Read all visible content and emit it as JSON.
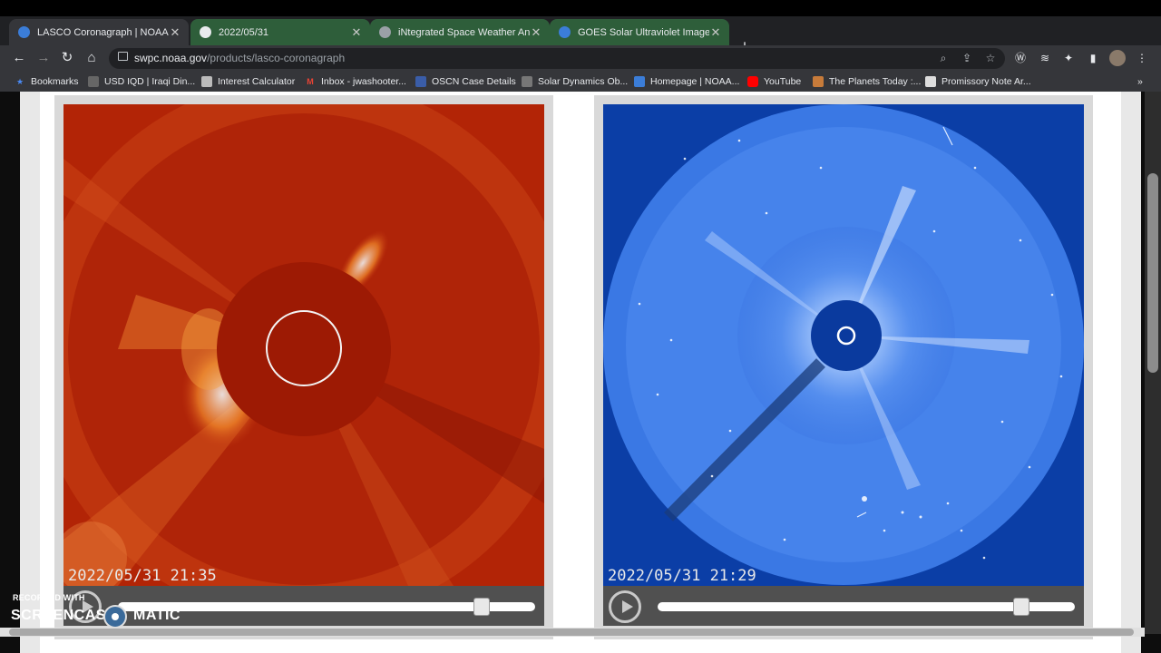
{
  "browser": {
    "tabs": [
      {
        "title": "LASCO Coronagraph | NOAA / N",
        "active": true,
        "favicon": "noaa-icon"
      },
      {
        "title": "2022/05/31",
        "active": false,
        "favicon": "globe-icon"
      },
      {
        "title": "iNtegrated Space Weather Analy",
        "active": false,
        "favicon": "satellite-icon"
      },
      {
        "title": "GOES Solar Ultraviolet Imager (S",
        "active": false,
        "favicon": "noaa-icon"
      }
    ],
    "close_glyph": "✕",
    "new_tab_glyph": "+",
    "url_domain": "swpc.noaa.gov",
    "url_path": "/products/lasco-coronagraph"
  },
  "bookmarks": [
    {
      "label": "Bookmarks",
      "icon": "star-icon"
    },
    {
      "label": "USD IQD | Iraqi Din...",
      "icon": "chart-icon"
    },
    {
      "label": "Interest Calculator",
      "icon": "calculator-icon"
    },
    {
      "label": "Inbox - jwashooter...",
      "icon": "gmail-icon"
    },
    {
      "label": "OSCN Case Details",
      "icon": "shield-icon"
    },
    {
      "label": "Solar Dynamics Ob...",
      "icon": "satellite-icon"
    },
    {
      "label": "Homepage | NOAA...",
      "icon": "noaa-icon"
    },
    {
      "label": "YouTube",
      "icon": "youtube-icon"
    },
    {
      "label": "The Planets Today :...",
      "icon": "planet-icon"
    },
    {
      "label": "Promissory Note Ar...",
      "icon": "document-icon"
    }
  ],
  "bookmarks_more": "»",
  "panels": [
    {
      "timestamp": "2022/05/31  21:35",
      "image": "lasco-c2-red",
      "slider_value": 1.0
    },
    {
      "timestamp": "2022/05/31  21:29",
      "image": "lasco-c3-blue",
      "slider_value": 1.0
    }
  ],
  "watermark": {
    "line1": "RECORDED WITH",
    "part1": "SCREENCAST",
    "part2": "MATIC"
  },
  "colors": {
    "red_panel": "#b72808",
    "blue_panel": "#0e45b0"
  }
}
